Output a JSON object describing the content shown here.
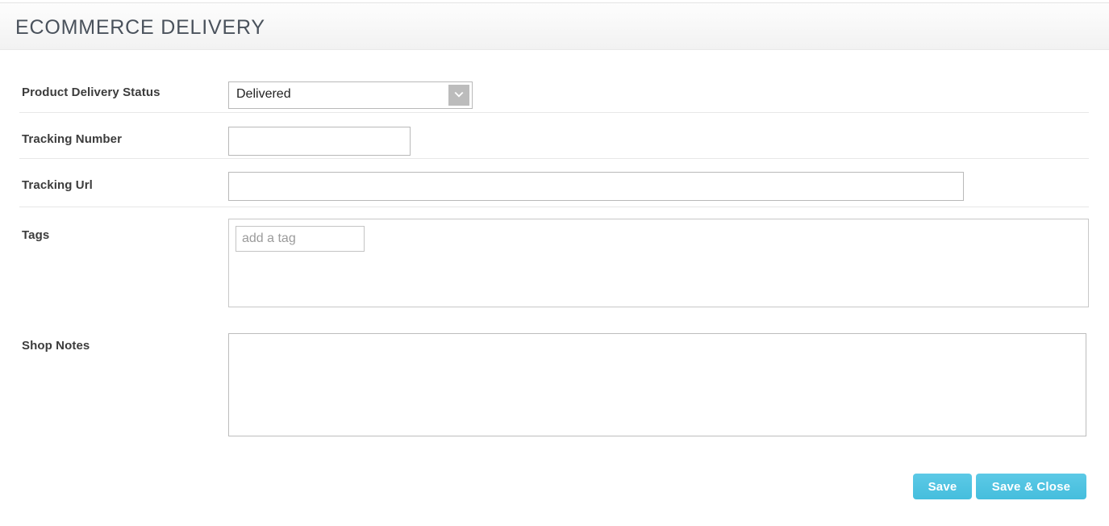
{
  "header": {
    "title": "ECOMMERCE DELIVERY"
  },
  "form": {
    "fields": [
      {
        "label": "Product Delivery Status",
        "type": "select",
        "value": "Delivered",
        "icon": "chevron-down-icon"
      },
      {
        "label": "Tracking Number",
        "type": "text",
        "value": "",
        "placeholder": ""
      },
      {
        "label": "Tracking Url",
        "type": "text",
        "value": "",
        "placeholder": ""
      },
      {
        "label": "Tags",
        "type": "tags",
        "value": "",
        "placeholder": "add a tag",
        "tags": []
      },
      {
        "label": "Shop Notes",
        "type": "textarea",
        "value": "",
        "placeholder": ""
      }
    ]
  },
  "footer": {
    "save_label": "Save",
    "save_close_label": "Save & Close"
  },
  "colors": {
    "accent": "#4cc2e0",
    "title_text": "#4a525c",
    "label_text": "#3c3c3c",
    "header_bg": "#f5f5f5",
    "border": "#b9b9b9",
    "rule": "#e7e7e7",
    "select_arrow_bg": "#bcbcbc"
  }
}
